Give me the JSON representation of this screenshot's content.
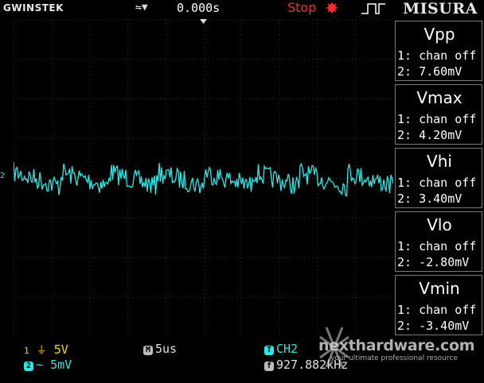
{
  "header": {
    "brand": "GWINSTEK",
    "trigger_icon": "trigger-slope-icon",
    "time_offset": "0.000s",
    "run_status": "Stop",
    "menu_title": "MISURA"
  },
  "measurements": [
    {
      "label": "Vpp",
      "ch1": "1: chan off",
      "ch2": "2: 7.60mV"
    },
    {
      "label": "Vmax",
      "ch1": "1: chan off",
      "ch2": "2: 4.20mV"
    },
    {
      "label": "Vhi",
      "ch1": "1: chan off",
      "ch2": "2: 3.40mV"
    },
    {
      "label": "Vlo",
      "ch1": "1: chan off",
      "ch2": "2: -2.80mV"
    },
    {
      "label": "Vmin",
      "ch1": "1: chan off",
      "ch2": "2: -3.40mV"
    }
  ],
  "channels": {
    "ch1": {
      "index": "1",
      "coupling_icon": "dc-ground-icon",
      "scale": "5V"
    },
    "ch2": {
      "index": "2",
      "coupling_icon": "ac-coupling-icon",
      "scale": "5mV"
    },
    "ch2_marker": "2"
  },
  "timebase": {
    "badge": "M",
    "scale": "5us"
  },
  "trigger": {
    "badge": "T",
    "source": "CH2"
  },
  "frequency": {
    "badge": "f",
    "value": "927.882kHz"
  },
  "watermark": {
    "site": "nexthardware.com",
    "tagline": "your ultimate professional resource"
  },
  "colors": {
    "ch1": "#ffd21a",
    "ch2": "#2fe6e6",
    "grid": "#2a2a2a",
    "stop": "#ff2a2a"
  }
}
